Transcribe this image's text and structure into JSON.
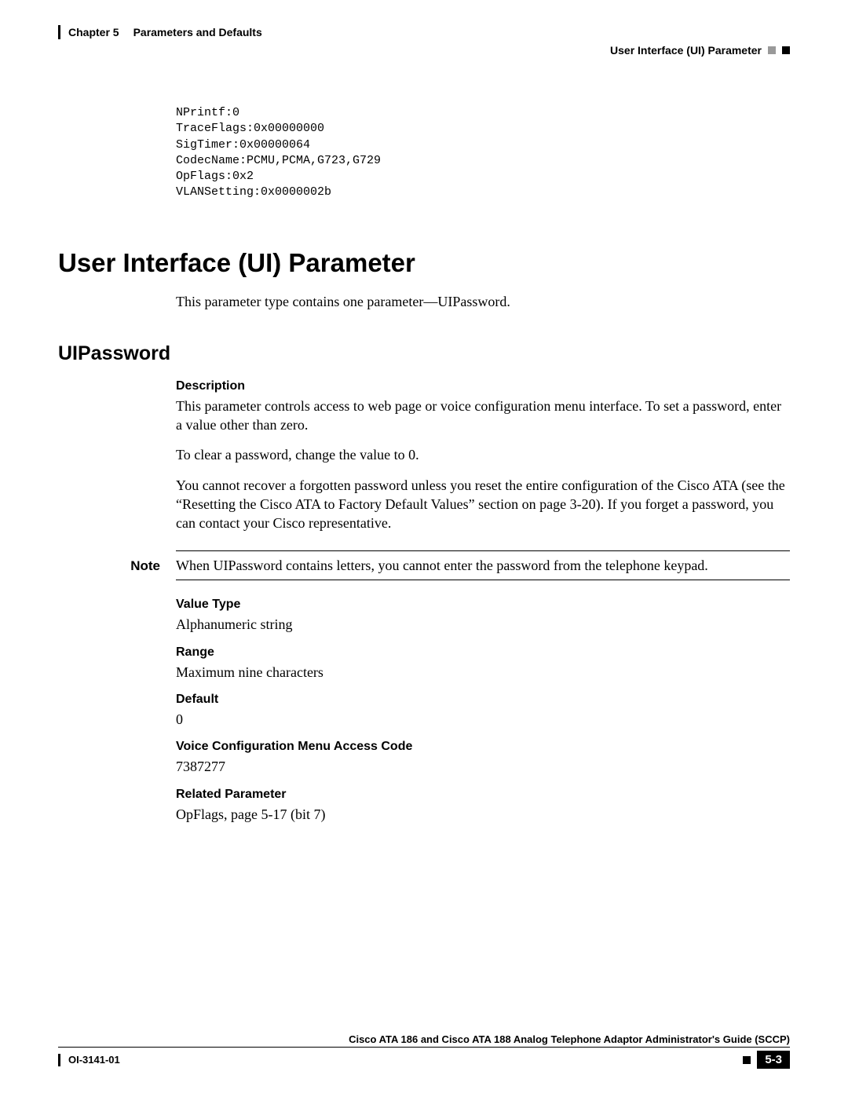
{
  "header": {
    "chapter_label": "Chapter 5",
    "chapter_title": "Parameters and Defaults",
    "section_title": "User Interface (UI) Parameter"
  },
  "code": "NPrintf:0\nTraceFlags:0x00000000\nSigTimer:0x00000064\nCodecName:PCMU,PCMA,G723,G729\nOpFlags:0x2\nVLANSetting:0x0000002b",
  "h1": "User Interface (UI) Parameter",
  "intro": "This parameter type contains one parameter—UIPassword.",
  "h2": "UIPassword",
  "desc_head": "Description",
  "desc_p1": "This parameter controls access to web page or voice configuration menu interface. To set a password, enter a value other than zero.",
  "desc_p2": "To clear a password, change the value to 0.",
  "desc_p3": "You cannot recover a forgotten password unless you reset the entire configuration of the Cisco ATA (see the “Resetting the Cisco ATA to Factory Default Values” section on page 3-20). If you forget a password, you can contact your Cisco representative.",
  "note_label": "Note",
  "note_text": "When UIPassword contains letters, you cannot enter the password from the telephone keypad.",
  "valtype_head": "Value Type",
  "valtype_text": "Alphanumeric string",
  "range_head": "Range",
  "range_text": "Maximum nine characters",
  "default_head": "Default",
  "default_text": "0",
  "vcmac_head": "Voice Configuration Menu Access Code",
  "vcmac_text": "7387277",
  "related_head": "Related Parameter",
  "related_text": "OpFlags, page 5-17 (bit 7)",
  "footer": {
    "guide": "Cisco ATA 186 and Cisco ATA 188 Analog Telephone Adaptor Administrator's Guide (SCCP)",
    "doc_id": "OI-3141-01",
    "page_num": "5-3"
  }
}
